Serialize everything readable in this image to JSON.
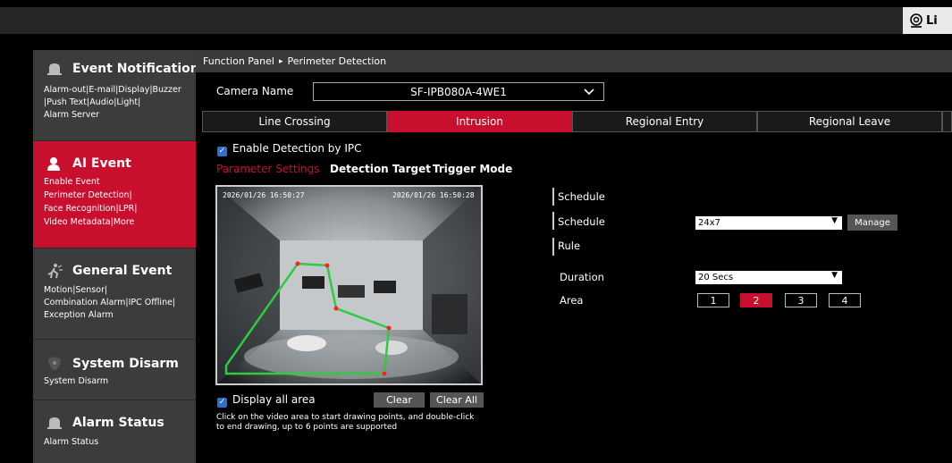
{
  "topbar": {
    "live_label": "Li"
  },
  "sidebar": [
    {
      "title": "Event Notification",
      "icon": "alarm-bell-icon",
      "sub": [
        "Alarm-out|E-mail|Display|Buzzer",
        "|Push Text|Audio|Light|",
        "Alarm Server"
      ]
    },
    {
      "title": "AI Event",
      "icon": "ai-person-icon",
      "sub": [
        "Enable Event",
        "Perimeter Detection|",
        "Face Recognition|LPR|",
        "Video Metadata|More"
      ]
    },
    {
      "title": "General Event",
      "icon": "motion-icon",
      "sub": [
        "Motion|Sensor|",
        "Combination Alarm|IPC Offline|",
        "Exception Alarm"
      ]
    },
    {
      "title": "System Disarm",
      "icon": "shield-icon",
      "sub": [
        "System Disarm"
      ]
    },
    {
      "title": "Alarm Status",
      "icon": "alarm-status-icon",
      "sub": [
        "Alarm Status"
      ]
    }
  ],
  "breadcrumb": {
    "root": "Function Panel",
    "sep": "▸",
    "current": "Perimeter Detection"
  },
  "camera": {
    "label": "Camera Name",
    "value": "SF-IPB080A-4WE1"
  },
  "tabs": [
    "Line Crossing",
    "Intrusion",
    "Regional Entry",
    "Regional Leave"
  ],
  "enable_detection": "Enable Detection by IPC",
  "subtabs": [
    "Parameter Settings",
    "Detection Target",
    "Trigger Mode"
  ],
  "video": {
    "osd_left": "2026/01/26 16:50:27",
    "osd_right": "2026/01/26 16:50:28"
  },
  "display_all_area": "Display all area",
  "clear_label": "Clear",
  "clear_all_label": "Clear All",
  "hint": "Click on the video area to start drawing points, and double-click to end drawing, up to 6 points are supported",
  "schedule_section": "Schedule",
  "schedule_label": "Schedule",
  "schedule_value": "24x7",
  "manage_label": "Manage",
  "rule_section": "Rule",
  "duration_label": "Duration",
  "duration_value": "20 Secs",
  "area_label": "Area",
  "areas": [
    "1",
    "2",
    "3",
    "4"
  ],
  "colors": {
    "accent": "#c8102e",
    "sidebar": "#3c3c3c",
    "zone": "#2ecc40",
    "zone_point": "#ff2020"
  }
}
